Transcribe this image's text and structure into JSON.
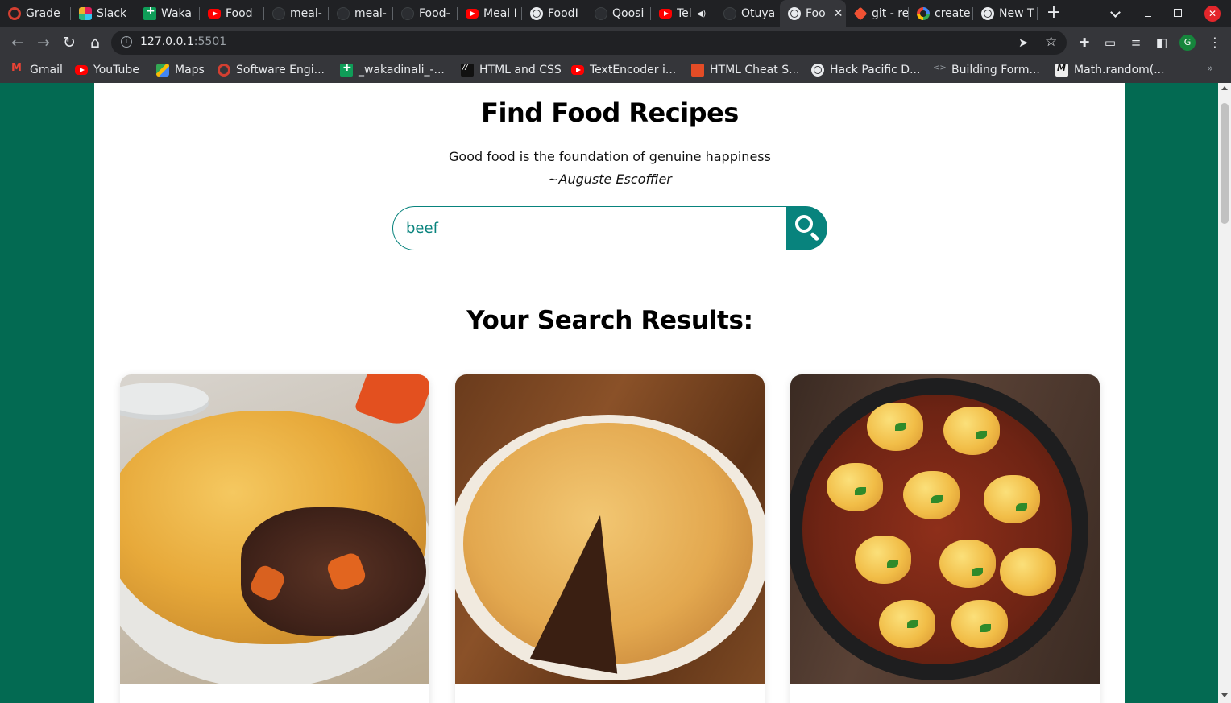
{
  "browser": {
    "tabs": [
      {
        "label": "Grade",
        "icon": "ring-icon"
      },
      {
        "label": "Slack",
        "icon": "slack-icon"
      },
      {
        "label": "Waka",
        "icon": "sheets-icon"
      },
      {
        "label": "Food",
        "icon": "youtube-icon"
      },
      {
        "label": "meal-",
        "icon": "github-icon"
      },
      {
        "label": "meal-",
        "icon": "github-icon"
      },
      {
        "label": "Food-",
        "icon": "github-icon"
      },
      {
        "label": "Meal I",
        "icon": "youtube-icon"
      },
      {
        "label": "FoodI",
        "icon": "globe-icon"
      },
      {
        "label": "Qoosi",
        "icon": "github-icon"
      },
      {
        "label": "Tel",
        "icon": "youtube-icon"
      },
      {
        "label": "Otuya",
        "icon": "github-icon"
      },
      {
        "label": "Foo",
        "icon": "globe-icon"
      },
      {
        "label": "git - re",
        "icon": "git-icon"
      },
      {
        "label": "create",
        "icon": "google-icon"
      },
      {
        "label": "New T",
        "icon": "globe-icon"
      }
    ],
    "window_close_glyph": "✕",
    "new_tab_glyph": "+",
    "url_host": "127.0.0.1",
    "url_port": ":5501",
    "profile_initial": "G",
    "bookmarks": [
      {
        "label": "Gmail",
        "icon": "gmail-icon"
      },
      {
        "label": "YouTube",
        "icon": "youtube-icon"
      },
      {
        "label": "Maps",
        "icon": "maps-icon"
      },
      {
        "label": "Software Engi...",
        "icon": "ring-icon"
      },
      {
        "label": "_wakadinali_-...",
        "icon": "sheets-icon"
      },
      {
        "label": "HTML and CSS",
        "icon": "slash-icon"
      },
      {
        "label": "TextEncoder i...",
        "icon": "youtube-icon"
      },
      {
        "label": "HTML Cheat S...",
        "icon": "gift-icon"
      },
      {
        "label": "Hack Pacific D...",
        "icon": "globe-icon"
      },
      {
        "label": "Building Form...",
        "icon": "code-icon"
      },
      {
        "label": "Math.random(...",
        "icon": "mm-icon"
      }
    ],
    "bookmarks_more_glyph": "»"
  },
  "page": {
    "title": "Find Food Recipes",
    "quote": "Good food is the foundation of genuine happiness",
    "quote_author": "~Auguste Escoffier",
    "search": {
      "value": "beef",
      "placeholder": ""
    },
    "results_title": "Your Search Results:",
    "results": [
      {
        "image_alt": "beef-and-vegetable-pie-image"
      },
      {
        "image_alt": "beef-pie-with-slice-removed-image"
      },
      {
        "image_alt": "beef-stew-with-dumplings-image"
      }
    ]
  },
  "colors": {
    "page_background": "#036a52",
    "accent": "#08837d",
    "chrome_dark": "#202124",
    "chrome_toolbar": "#35363a"
  }
}
